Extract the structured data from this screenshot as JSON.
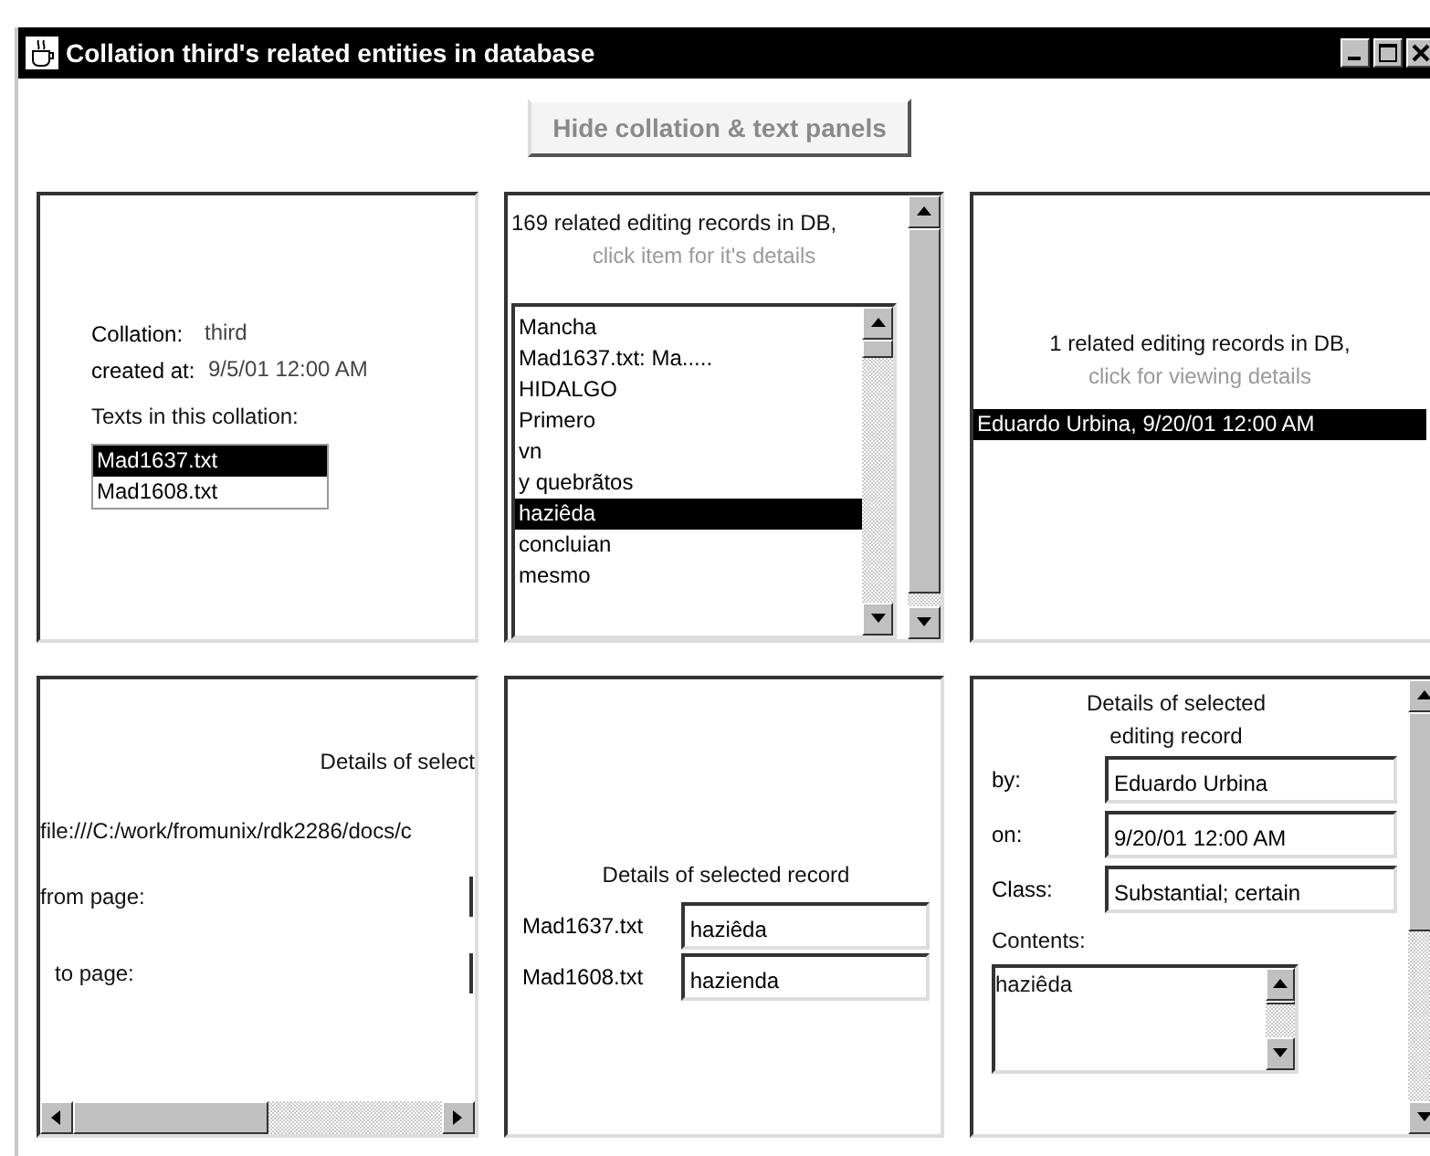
{
  "window": {
    "title": "Collation third's related entities in database"
  },
  "hide_button": "Hide collation & text panels",
  "collation_panel": {
    "fields": [
      {
        "label": "Collation:",
        "value": "third"
      },
      {
        "label": "created at:",
        "value": "9/5/01 12:00 AM"
      }
    ],
    "texts_label": "Texts in this collation:",
    "texts": [
      {
        "label": "Mad1637.txt",
        "selected": true
      },
      {
        "label": "Mad1608.txt",
        "selected": false
      }
    ]
  },
  "records_panel": {
    "header": "169 related editing records in DB,",
    "hint": "click item for it's details",
    "items": [
      {
        "label": "Mancha",
        "selected": false
      },
      {
        "label": "Mad1637.txt: Ma.....",
        "selected": false
      },
      {
        "label": "HIDALGO",
        "selected": false
      },
      {
        "label": "Primero",
        "selected": false
      },
      {
        "label": "vn",
        "selected": false
      },
      {
        "label": "y quebrãtos",
        "selected": false
      },
      {
        "label": "haziêda",
        "selected": true
      },
      {
        "label": "concluian",
        "selected": false
      },
      {
        "label": "mesmo",
        "selected": false
      }
    ]
  },
  "related_panel": {
    "header": "1 related editing records in DB,",
    "hint": "click for viewing details",
    "items": [
      {
        "label": "Eduardo Urbina, 9/20/01 12:00 AM",
        "selected": true
      }
    ]
  },
  "source_panel": {
    "title": "Details of select",
    "path": "file:///C:/work/fromunix/rdk2286/docs/c",
    "from_label": "from page:",
    "to_label": "to page:"
  },
  "record_panel": {
    "title": "Details of selected record",
    "rows": [
      {
        "label": "Mad1637.txt",
        "value": "haziêda"
      },
      {
        "label": "Mad1608.txt",
        "value": "hazienda"
      }
    ]
  },
  "editing_panel": {
    "title_lines": [
      "Details of selected",
      "editing record"
    ],
    "fields": [
      {
        "label": "by:",
        "value": "Eduardo Urbina"
      },
      {
        "label": "on:",
        "value": "9/20/01 12:00 AM"
      },
      {
        "label": "Class:",
        "value": "Substantial; certain"
      }
    ],
    "contents_label": "Contents:",
    "contents": "haziêda"
  }
}
